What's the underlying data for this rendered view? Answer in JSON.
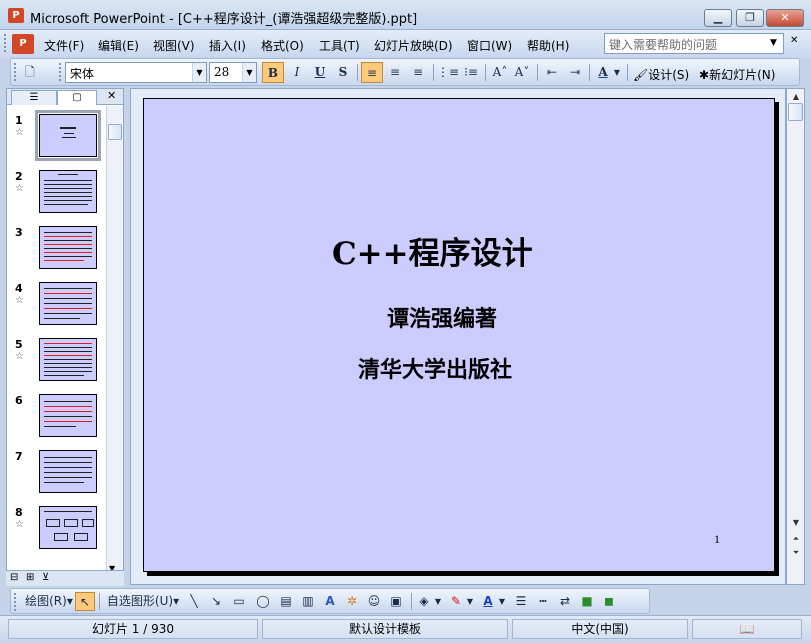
{
  "window": {
    "title": "Microsoft PowerPoint - [C++程序设计_(谭浩强超级完整版).ppt]",
    "app_icon": "powerpoint-icon",
    "buttons": [
      "minimize",
      "restore",
      "close"
    ]
  },
  "menu": {
    "items": [
      "文件(F)",
      "编辑(E)",
      "视图(V)",
      "插入(I)",
      "格式(O)",
      "工具(T)",
      "幻灯片放映(D)",
      "窗口(W)",
      "帮助(H)"
    ],
    "help_placeholder": "键入需要帮助的问题"
  },
  "format_toolbar": {
    "font": "宋体",
    "size": "28",
    "bold": "B",
    "italic": "I",
    "underline": "U",
    "shadow": "S",
    "design_label": "设计(S)",
    "new_slide_label": "新幻灯片(N)"
  },
  "outline_pane": {
    "tabs": [
      "outline-tab",
      "slides-tab"
    ],
    "slides": [
      {
        "num": "1",
        "star": "☆"
      },
      {
        "num": "2",
        "star": "☆"
      },
      {
        "num": "3",
        "star": ""
      },
      {
        "num": "4",
        "star": "☆"
      },
      {
        "num": "5",
        "star": "☆"
      },
      {
        "num": "6",
        "star": ""
      },
      {
        "num": "7",
        "star": ""
      },
      {
        "num": "8",
        "star": "☆"
      }
    ]
  },
  "slide": {
    "title": "C++程序设计",
    "line1": "谭浩强编著",
    "line2": "清华大学出版社",
    "number": "1",
    "background": "#ccccff"
  },
  "draw_toolbar": {
    "draw_label": "绘图(R)",
    "autoshapes_label": "自选图形(U)"
  },
  "status": {
    "slide": "幻灯片 1 / 930",
    "template": "默认设计模板",
    "language": "中文(中国)"
  }
}
